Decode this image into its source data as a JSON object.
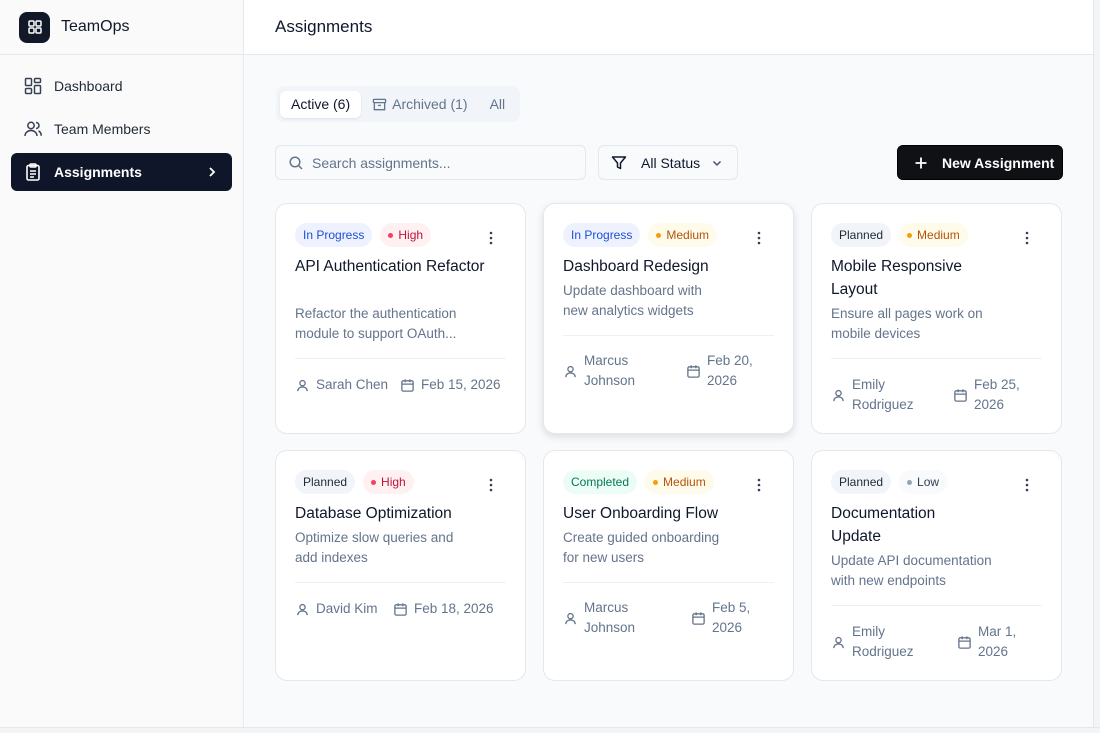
{
  "app": {
    "name": "TeamOps",
    "logo_icon": "grid-icon"
  },
  "sidebar": {
    "items": [
      {
        "label": "Dashboard",
        "icon": "dashboard-icon",
        "active": false
      },
      {
        "label": "Team Members",
        "icon": "users-icon",
        "active": false
      },
      {
        "label": "Assignments",
        "icon": "clipboard-icon",
        "active": true
      }
    ]
  },
  "header": {
    "title": "Assignments"
  },
  "tabs": [
    {
      "label": "Active (6)",
      "active": true
    },
    {
      "label": "Archived (1)",
      "icon": "archive-icon",
      "active": false
    },
    {
      "label": "All",
      "active": false
    }
  ],
  "search": {
    "placeholder": "Search assignments...",
    "value": ""
  },
  "filter": {
    "label": "All Status",
    "icon": "filter-icon"
  },
  "new_button": {
    "label": "New Assignment",
    "icon": "plus-icon"
  },
  "colors": {
    "in_progress_bg": "#eef2ff",
    "in_progress_fg": "#1d4ed8",
    "high_bg": "#fff1f2",
    "high_fg": "#be123c",
    "high_dot": "#f43f5e",
    "medium_bg": "#fffbeb",
    "medium_fg": "#b45309",
    "medium_dot": "#f59e0b",
    "planned_bg": "#f1f5f9",
    "planned_fg": "#1f2937",
    "completed_bg": "#ecfdf5",
    "completed_fg": "#047857",
    "low_bg": "#f8fafc",
    "low_fg": "#334155",
    "low_dot": "#94a3b8",
    "accent": "#0f1629"
  },
  "assignments": [
    {
      "status": "In Progress",
      "priority": "High",
      "title": "API Authentication Refactor",
      "description": "Refactor the authentication module to support OAuth...",
      "assignee": "Sarah Chen",
      "due": "Feb 15, 2026"
    },
    {
      "status": "In Progress",
      "priority": "Medium",
      "title": "Dashboard Redesign",
      "description": "Update dashboard with new analytics widgets",
      "assignee": "Marcus Johnson",
      "due": "Feb 20, 2026"
    },
    {
      "status": "Planned",
      "priority": "Medium",
      "title": "Mobile Responsive Layout",
      "description": "Ensure all pages work on mobile devices",
      "assignee": "Emily Rodriguez",
      "due": "Feb 25, 2026"
    },
    {
      "status": "Planned",
      "priority": "High",
      "title": "Database Optimization",
      "description": "Optimize slow queries and add indexes",
      "assignee": "David Kim",
      "due": "Feb 18, 2026"
    },
    {
      "status": "Completed",
      "priority": "Medium",
      "title": "User Onboarding Flow",
      "description": "Create guided onboarding for new users",
      "assignee": "Marcus Johnson",
      "due": "Feb 5, 2026"
    },
    {
      "status": "Planned",
      "priority": "Low",
      "title": "Documentation Update",
      "description": "Update API documentation with new endpoints",
      "assignee": "Emily Rodriguez",
      "due": "Mar 1, 2026"
    }
  ]
}
